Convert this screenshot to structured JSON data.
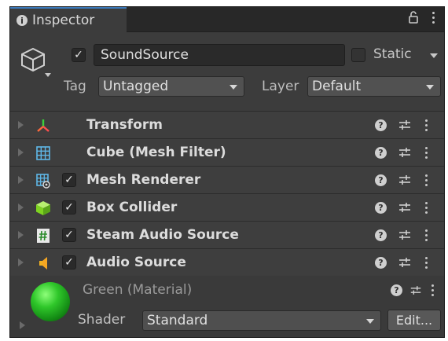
{
  "tab": {
    "title": "Inspector"
  },
  "gameobject": {
    "active": true,
    "name": "SoundSource",
    "static_label": "Static",
    "is_static": false,
    "tag_label": "Tag",
    "tag_value": "Untagged",
    "layer_label": "Layer",
    "layer_value": "Default"
  },
  "components": [
    {
      "name": "Transform",
      "icon": "transform-icon",
      "has_checkbox": false
    },
    {
      "name": "Cube (Mesh Filter)",
      "icon": "mesh-filter-icon",
      "has_checkbox": false
    },
    {
      "name": "Mesh Renderer",
      "icon": "mesh-renderer-icon",
      "has_checkbox": true,
      "enabled": true
    },
    {
      "name": "Box Collider",
      "icon": "box-collider-icon",
      "has_checkbox": true,
      "enabled": true
    },
    {
      "name": "Steam Audio Source",
      "icon": "script-icon",
      "has_checkbox": true,
      "enabled": true
    },
    {
      "name": "Audio Source",
      "icon": "audio-source-icon",
      "has_checkbox": true,
      "enabled": true
    }
  ],
  "material": {
    "name": "Green (Material)",
    "shader_label": "Shader",
    "shader_value": "Standard",
    "edit_label": "Edit...",
    "color": "#2fc72a"
  },
  "colors": {
    "panel_bg": "#383838",
    "tab_accent": "#3a79bb"
  }
}
